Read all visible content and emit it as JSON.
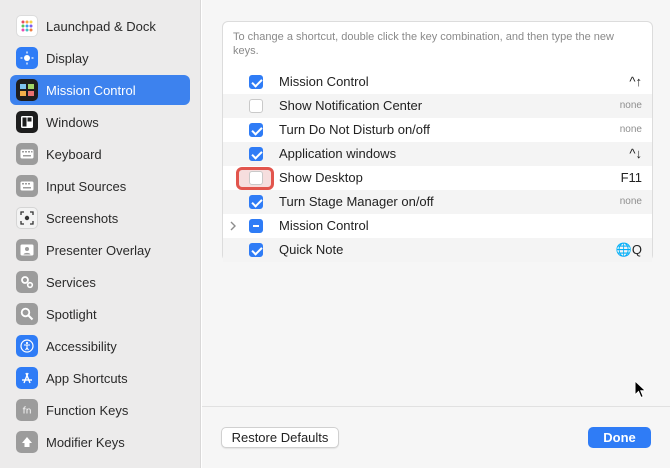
{
  "sidebar": {
    "items": [
      {
        "label": "Launchpad & Dock",
        "icon": "launchpad-dock-icon",
        "color": "#3a3a3a"
      },
      {
        "label": "Display",
        "icon": "display-icon",
        "color": "#2f7cf6"
      },
      {
        "label": "Mission Control",
        "icon": "mission-control-icon",
        "color": "#222222",
        "active": true
      },
      {
        "label": "Windows",
        "icon": "windows-icon",
        "color": "#222222"
      },
      {
        "label": "Keyboard",
        "icon": "keyboard-icon",
        "color": "#9a9a9a"
      },
      {
        "label": "Input Sources",
        "icon": "input-sources-icon",
        "color": "#9a9a9a"
      },
      {
        "label": "Screenshots",
        "icon": "screenshots-icon",
        "color": "#f0f0f0"
      },
      {
        "label": "Presenter Overlay",
        "icon": "presenter-overlay-icon",
        "color": "#9a9a9a"
      },
      {
        "label": "Services",
        "icon": "services-icon",
        "color": "#9a9a9a"
      },
      {
        "label": "Spotlight",
        "icon": "spotlight-icon",
        "color": "#9a9a9a"
      },
      {
        "label": "Accessibility",
        "icon": "accessibility-icon",
        "color": "#2f7cf6"
      },
      {
        "label": "App Shortcuts",
        "icon": "app-shortcuts-icon",
        "color": "#2f7cf6"
      },
      {
        "label": "Function Keys",
        "icon": "function-keys-icon",
        "color": "#9a9a9a"
      },
      {
        "label": "Modifier Keys",
        "icon": "modifier-keys-icon",
        "color": "#9a9a9a"
      }
    ]
  },
  "main": {
    "hint": "To change a shortcut, double click the key combination, and then type the new keys.",
    "rows": [
      {
        "label": "Mission Control",
        "checked": "on",
        "key": "^↑"
      },
      {
        "label": "Show Notification Center",
        "checked": "off",
        "key": "none"
      },
      {
        "label": "Turn Do Not Disturb on/off",
        "checked": "on",
        "key": "none"
      },
      {
        "label": "Application windows",
        "checked": "on",
        "key": "^↓"
      },
      {
        "label": "Show Desktop",
        "checked": "off",
        "key": "F11",
        "highlighted": true
      },
      {
        "label": "Turn Stage Manager on/off",
        "checked": "on",
        "key": "none"
      },
      {
        "label": "Mission Control",
        "checked": "mixed",
        "key": "",
        "expandable": true
      },
      {
        "label": "Quick Note",
        "checked": "on",
        "key": "🌐Q"
      }
    ],
    "restore_label": "Restore Defaults",
    "done_label": "Done"
  },
  "colors": {
    "accent": "#2f7cf6",
    "highlight_border": "#e2554d"
  }
}
